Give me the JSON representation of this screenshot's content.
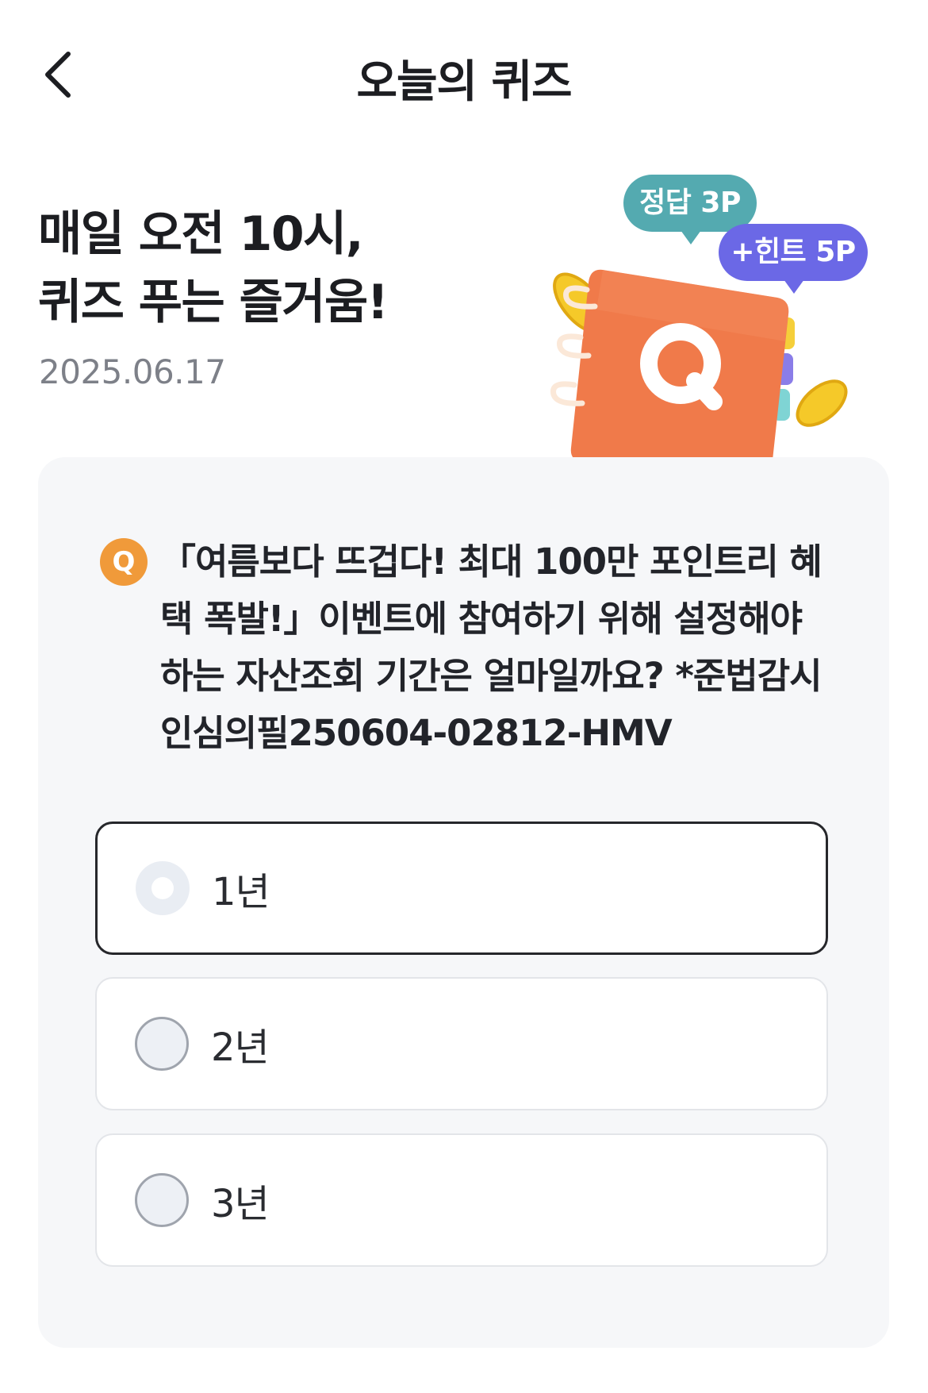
{
  "header": {
    "title": "오늘의 퀴즈"
  },
  "hero": {
    "title_line1": "매일 오전 10시,",
    "title_line2": "퀴즈 푸는 즐거움!",
    "date": "2025.06.17"
  },
  "illustration": {
    "answer_bubble": "정답 3P",
    "hint_bubble": "+힌트 5P",
    "notebook_letter": "Q",
    "colors": {
      "notebook": "#f07a4a",
      "coin": "#f5c929",
      "answer_bubble": "#54aab0",
      "hint_bubble": "#6b68e6"
    }
  },
  "quiz": {
    "badge": "Q",
    "badge_color": "#f09a3a",
    "question": "「여름보다 뜨겁다! 최대 100만 포인트리 혜택 폭발!」이벤트에 참여하기 위해 설정해야 하는 자산조회 기간은 얼마일까요? *준법감시인심의필250604-02812-HMV",
    "options": [
      {
        "label": "1년",
        "state": "focused"
      },
      {
        "label": "2년",
        "state": "default"
      },
      {
        "label": "3년",
        "state": "default"
      }
    ]
  }
}
